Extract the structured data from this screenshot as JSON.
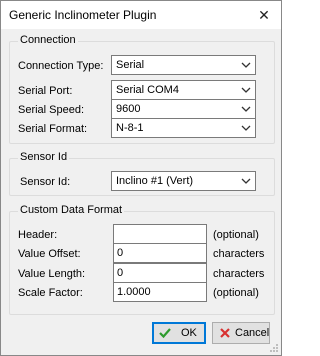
{
  "window": {
    "title": "Generic Inclinometer Plugin",
    "close_glyph": "✕"
  },
  "connection": {
    "group_label": "Connection",
    "type_label": "Connection Type:",
    "type_value": "Serial",
    "port_label": "Serial Port:",
    "port_value": "Serial COM4",
    "speed_label": "Serial Speed:",
    "speed_value": "9600",
    "format_label": "Serial Format:",
    "format_value": "N-8-1"
  },
  "sensor": {
    "group_label": "Sensor Id",
    "id_label": "Sensor Id:",
    "id_value": "Inclino #1 (Vert)"
  },
  "custom": {
    "group_label": "Custom Data Format",
    "header_label": "Header:",
    "header_value": "",
    "header_hint": "(optional)",
    "offset_label": "Value Offset:",
    "offset_value": "0",
    "offset_unit": "characters",
    "length_label": "Value Length:",
    "length_value": "0",
    "length_unit": "characters",
    "scale_label": "Scale Factor:",
    "scale_value": "1.0000",
    "scale_hint": "(optional)"
  },
  "buttons": {
    "ok_label": "OK",
    "cancel_label": "Cancel"
  },
  "colors": {
    "ok_check": "#2e9b2e",
    "cancel_x": "#d83030",
    "focus_border": "#0078d7"
  }
}
